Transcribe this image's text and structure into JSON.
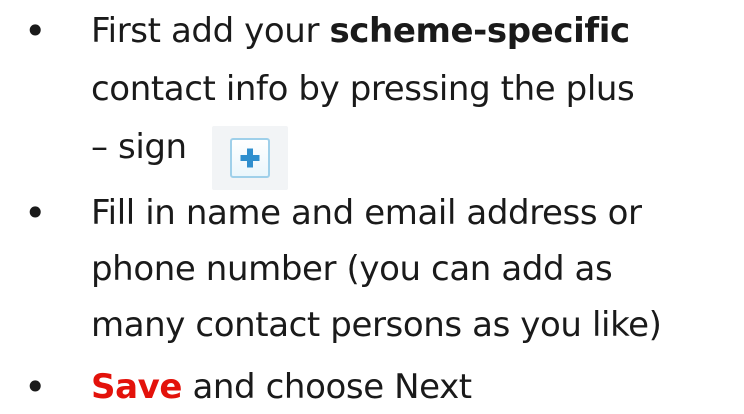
{
  "bullets": [
    {
      "lines": [
        {
          "before": "First add your ",
          "bold": "scheme-specific",
          "after": ""
        },
        {
          "text": "contact info by pressing the plus"
        },
        {
          "text": "– sign"
        }
      ]
    },
    {
      "lines": [
        {
          "text": "Fill in name and email address or"
        },
        {
          "text": "phone number (you can add as"
        },
        {
          "text": "many contact persons as you like)"
        }
      ]
    },
    {
      "lines": [
        {
          "highlight": "Save",
          "after": " and choose Next"
        }
      ]
    }
  ],
  "bullet_symbol": "•",
  "icons": {
    "plus_button": "plus-icon"
  },
  "colors": {
    "text": "#1a1a1a",
    "highlight": "#e3120b",
    "plus_icon": "#2f8fce",
    "plus_border": "#9fd0ea"
  }
}
